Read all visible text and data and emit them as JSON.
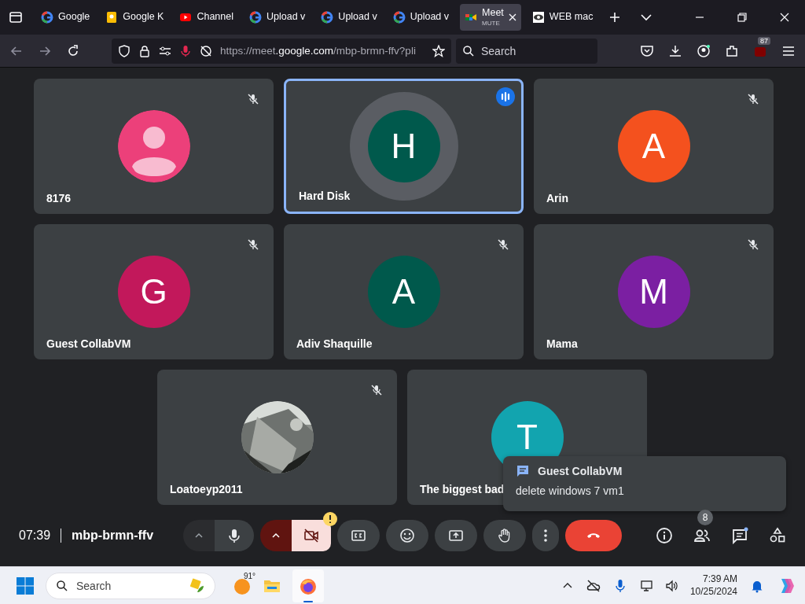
{
  "tabs": [
    {
      "label": "Google",
      "selected": false
    },
    {
      "label": "Google K",
      "selected": false
    },
    {
      "label": "Channel",
      "selected": false
    },
    {
      "label": "Upload v",
      "selected": false
    },
    {
      "label": "Upload v",
      "selected": false
    },
    {
      "label": "Upload v",
      "selected": false
    },
    {
      "label": "Meet",
      "sublabel": "MUTE",
      "selected": true
    },
    {
      "label": "WEB mac",
      "selected": false
    }
  ],
  "toolbar": {
    "url_host": "https://meet.google.com",
    "url_path": "/mbp-brmn-ffv?pli",
    "search_placeholder": "Search",
    "extension_badge": "87"
  },
  "tiles": [
    {
      "name": "8176",
      "kind": "silhouette",
      "color": "#ec407a",
      "muted": true,
      "speaking": false
    },
    {
      "name": "Hard Disk",
      "kind": "letter",
      "initial": "H",
      "color": "#00594c",
      "muted": false,
      "speaking": true
    },
    {
      "name": "Arin",
      "kind": "letter",
      "initial": "A",
      "color": "#f4511e",
      "muted": true,
      "speaking": false
    },
    {
      "name": "Guest CollabVM",
      "kind": "letter",
      "initial": "G",
      "color": "#c2185b",
      "muted": true,
      "speaking": false
    },
    {
      "name": "Adiv Shaquille",
      "kind": "letter",
      "initial": "A",
      "color": "#00594c",
      "muted": true,
      "speaking": false
    },
    {
      "name": "Mama",
      "kind": "letter",
      "initial": "M",
      "color": "#7b1fa2",
      "muted": true,
      "speaking": false
    },
    {
      "name": "Loatoeyp2011",
      "kind": "picture",
      "muted": true,
      "speaking": false
    },
    {
      "name": "The biggest bad",
      "kind": "letter",
      "initial": "T",
      "color": "#12a4af",
      "muted": false,
      "speaking": false
    }
  ],
  "toast": {
    "sender": "Guest CollabVM",
    "message": "delete windows 7 vm1"
  },
  "meeting": {
    "time": "07:39",
    "code": "mbp-brmn-ffv",
    "mic_on": true,
    "camera_on": false,
    "people_count": "8"
  },
  "taskbar": {
    "search_placeholder": "Search",
    "temperature": "91°",
    "time": "7:39 AM",
    "date": "10/25/2024"
  }
}
